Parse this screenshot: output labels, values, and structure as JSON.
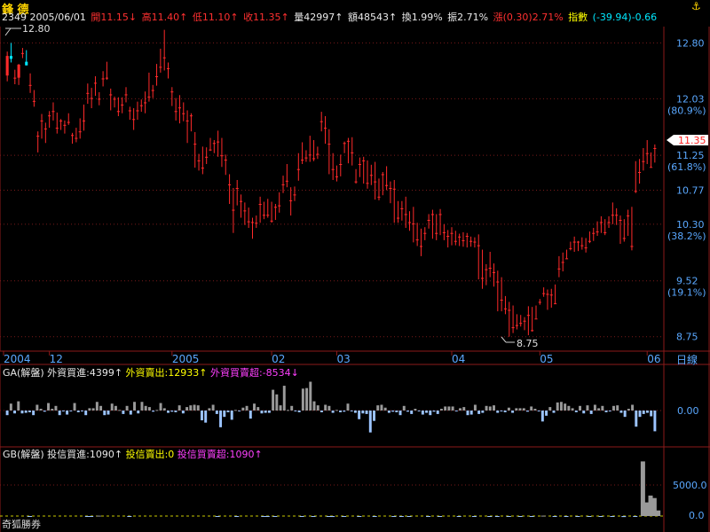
{
  "header": {
    "ticker_name": "鋒 德",
    "code_date": "2349 2005/06/01",
    "open": "開11.15↓",
    "high": "高11.40↑",
    "low": "低11.10↑",
    "close": "收11.35↑",
    "volume": "量42997↑",
    "amount": "額48543↑",
    "turnover": "換1.99%",
    "amplitude": "振2.71%",
    "change": "漲(0.30)2.71%",
    "index_label": "指數",
    "index_value": "(-39.94)-0.66",
    "anchor_icon": "anchor-icon"
  },
  "colors": {
    "up": "#ff2a2a",
    "down": "#00e6ff",
    "grid": "#7a1a1a",
    "frame": "#8b1a1a",
    "axis_text": "#5aa8ff",
    "pos_bar": "#9a9a9a",
    "neg_bar": "#9cc4ff"
  },
  "chart_data": [
    {
      "type": "candlestick",
      "title": "",
      "y_ticks": [
        "12.80",
        "12.03",
        "11.25",
        "10.77",
        "10.30",
        "9.52",
        "8.75"
      ],
      "y_pct_ticks": [
        "(80.9%)",
        "(61.8%)",
        "(38.2%)",
        "(19.1%)"
      ],
      "ylim": [
        8.6,
        13.0
      ],
      "x_ticks": [
        "2004",
        "12",
        "2005",
        "02",
        "03",
        "04",
        "05",
        "06"
      ],
      "x_period_label": "日線",
      "current_price_label": "11.35",
      "max_annotation": "12.80",
      "min_annotation": "8.75",
      "ohlc_open": [
        12.35,
        12.62,
        12.32,
        12.32,
        12.66,
        12.54,
        12.22,
        12.0,
        11.52,
        11.73,
        11.62,
        11.8,
        11.86,
        11.63,
        11.73,
        11.67,
        11.71,
        11.53,
        11.49,
        11.58,
        11.73,
        12.11,
        12.04,
        12.25,
        12.03,
        12.31,
        12.32,
        12.09,
        12.03,
        11.86,
        11.95,
        12.09,
        11.87,
        11.75,
        11.87,
        11.94,
        11.98,
        12.06,
        12.15,
        12.34,
        12.47,
        12.6,
        12.45,
        12.13,
        11.86,
        11.91,
        11.83,
        11.73,
        11.8,
        11.41,
        11.18,
        11.08,
        11.23,
        11.33,
        11.42,
        11.44,
        11.25,
        11.19,
        10.85,
        10.5,
        10.8,
        10.62,
        10.49,
        10.34,
        10.33,
        10.32,
        10.58,
        10.43,
        10.43,
        10.35,
        10.54,
        10.56,
        10.85,
        10.9,
        10.63,
        10.71,
        11.06,
        11.19,
        11.22,
        11.26,
        11.21,
        11.27,
        11.72,
        11.63,
        11.41,
        11.06,
        10.96,
        11.13,
        11.42,
        11.45,
        11.29,
        10.89,
        11.13,
        11.18,
        10.87,
        10.98,
        10.89,
        10.68,
        10.99,
        10.84,
        10.8,
        10.79,
        10.39,
        10.52,
        10.44,
        10.33,
        10.31,
        10.09,
        10.0,
        10.18,
        10.36,
        10.44,
        10.18,
        10.44,
        10.19,
        10.14,
        10.18,
        10.07,
        10.13,
        10.08,
        10.14,
        10.07,
        10.06,
        10.01,
        9.56,
        9.68,
        9.7,
        9.64,
        9.51,
        9.26,
        9.14,
        9.12,
        8.88,
        8.91,
        8.94,
        8.97,
        9.05,
        8.84,
        9.0,
        9.23,
        9.35,
        9.34,
        9.33,
        9.21,
        9.69,
        9.78,
        9.83,
        9.97,
        10.06,
        10.06,
        10.01,
        9.98,
        10.07,
        10.18,
        10.2,
        10.33,
        10.19,
        10.33,
        10.43,
        10.43,
        10.36,
        10.11,
        10.42,
        10.0,
        10.76,
        11.02,
        11.17,
        11.28,
        11.09,
        11.35
      ],
      "ohlc_high": [
        12.68,
        12.8,
        12.43,
        12.51,
        12.73,
        12.7,
        12.38,
        12.15,
        11.58,
        11.82,
        11.7,
        11.86,
        11.98,
        11.84,
        11.75,
        11.73,
        11.83,
        11.56,
        11.63,
        11.76,
        11.95,
        12.24,
        12.18,
        12.34,
        12.12,
        12.41,
        12.54,
        12.17,
        12.06,
        12.05,
        12.05,
        12.19,
        11.92,
        11.9,
        11.99,
        12.02,
        12.13,
        12.39,
        12.22,
        12.51,
        12.72,
        12.98,
        12.53,
        12.19,
        12.04,
        12.08,
        11.98,
        11.87,
        11.83,
        11.57,
        11.27,
        11.37,
        11.36,
        11.49,
        11.46,
        11.59,
        11.49,
        11.26,
        10.99,
        10.8,
        10.91,
        10.71,
        10.6,
        10.53,
        10.39,
        10.42,
        10.68,
        10.61,
        10.65,
        10.61,
        10.58,
        10.74,
        10.97,
        11.13,
        10.81,
        10.82,
        11.28,
        11.43,
        11.32,
        11.52,
        11.46,
        11.37,
        11.85,
        11.79,
        11.61,
        11.28,
        11.11,
        11.26,
        11.44,
        11.49,
        11.5,
        11.06,
        11.22,
        11.23,
        11.18,
        11.12,
        11.16,
        10.93,
        11.02,
        11.1,
        10.89,
        10.91,
        10.62,
        10.62,
        10.68,
        10.48,
        10.54,
        10.32,
        10.24,
        10.26,
        10.44,
        10.5,
        10.44,
        10.51,
        10.3,
        10.22,
        10.26,
        10.21,
        10.17,
        10.19,
        10.18,
        10.13,
        10.12,
        10.16,
        9.95,
        9.75,
        9.92,
        9.76,
        9.66,
        9.57,
        9.31,
        9.23,
        9.18,
        9.06,
        9.05,
        9.02,
        9.17,
        9.16,
        9.18,
        9.27,
        9.43,
        9.4,
        9.41,
        9.47,
        9.86,
        9.91,
        9.95,
        10.06,
        10.13,
        10.07,
        10.12,
        10.11,
        10.2,
        10.25,
        10.34,
        10.41,
        10.37,
        10.41,
        10.6,
        10.52,
        10.42,
        10.37,
        10.5,
        10.54,
        11.17,
        11.2,
        11.35,
        11.46,
        11.29,
        11.4
      ],
      "ohlc_low": [
        12.27,
        12.53,
        12.23,
        12.22,
        12.59,
        12.49,
        12.11,
        11.92,
        11.29,
        11.48,
        11.42,
        11.63,
        11.73,
        11.55,
        11.6,
        11.55,
        11.67,
        11.41,
        11.43,
        11.48,
        11.59,
        11.96,
        11.9,
        12.07,
        11.94,
        12.2,
        12.29,
        11.87,
        11.91,
        11.79,
        11.83,
        11.98,
        11.74,
        11.6,
        11.74,
        11.85,
        11.83,
        11.99,
        12.04,
        12.21,
        12.39,
        12.42,
        12.31,
        11.93,
        11.73,
        11.69,
        11.72,
        11.42,
        11.58,
        11.08,
        11.04,
        10.99,
        11.13,
        11.31,
        11.28,
        11.23,
        11.09,
        10.98,
        10.58,
        10.18,
        10.56,
        10.39,
        10.29,
        10.25,
        10.1,
        10.25,
        10.32,
        10.37,
        10.39,
        10.32,
        10.36,
        10.46,
        10.73,
        10.81,
        10.42,
        10.62,
        10.9,
        11.13,
        11.16,
        11.16,
        11.17,
        11.2,
        11.58,
        11.41,
        10.99,
        10.91,
        10.89,
        10.96,
        11.28,
        11.14,
        11.11,
        10.86,
        10.95,
        10.86,
        10.79,
        10.84,
        10.64,
        10.63,
        10.7,
        10.77,
        10.59,
        10.32,
        10.32,
        10.35,
        10.25,
        10.21,
        10.05,
        10.0,
        9.86,
        10.08,
        10.24,
        10.1,
        10.08,
        10.15,
        10.08,
        9.98,
        10.01,
        10.01,
        10.0,
        9.99,
        9.98,
        9.99,
        9.98,
        9.54,
        9.41,
        9.46,
        9.57,
        9.44,
        9.1,
        9.1,
        9.06,
        8.75,
        8.8,
        8.85,
        8.89,
        8.84,
        8.77,
        8.82,
        9.0,
        9.19,
        9.3,
        9.12,
        9.15,
        9.21,
        9.57,
        9.65,
        9.83,
        9.94,
        9.92,
        9.93,
        9.95,
        9.91,
        10.04,
        10.07,
        10.14,
        10.18,
        10.15,
        10.25,
        10.3,
        10.29,
        10.03,
        10.06,
        10.14,
        9.94,
        10.73,
        10.86,
        11.04,
        11.13,
        11.09,
        11.15
      ],
      "ohlc_close": [
        12.62,
        12.58,
        12.32,
        12.5,
        12.66,
        12.49,
        12.22,
        12.0,
        11.52,
        11.73,
        11.62,
        11.8,
        11.86,
        11.63,
        11.73,
        11.67,
        11.71,
        11.53,
        11.49,
        11.58,
        11.73,
        12.11,
        12.04,
        12.25,
        12.03,
        12.31,
        12.32,
        12.09,
        12.03,
        11.86,
        11.95,
        12.09,
        11.87,
        11.75,
        11.87,
        11.94,
        11.98,
        12.06,
        12.15,
        12.34,
        12.47,
        12.6,
        12.45,
        12.13,
        11.86,
        11.91,
        11.83,
        11.73,
        11.8,
        11.41,
        11.18,
        11.08,
        11.23,
        11.33,
        11.42,
        11.44,
        11.25,
        11.19,
        10.85,
        10.5,
        10.8,
        10.62,
        10.49,
        10.34,
        10.33,
        10.32,
        10.58,
        10.43,
        10.43,
        10.35,
        10.54,
        10.56,
        10.85,
        10.9,
        10.63,
        10.71,
        11.06,
        11.19,
        11.22,
        11.26,
        11.21,
        11.27,
        11.72,
        11.63,
        11.41,
        11.06,
        10.96,
        11.13,
        11.42,
        11.45,
        11.29,
        10.89,
        11.13,
        11.18,
        10.87,
        10.98,
        10.89,
        10.68,
        10.99,
        10.84,
        10.8,
        10.79,
        10.39,
        10.52,
        10.44,
        10.33,
        10.31,
        10.09,
        10.0,
        10.18,
        10.36,
        10.44,
        10.18,
        10.44,
        10.19,
        10.14,
        10.18,
        10.07,
        10.13,
        10.08,
        10.14,
        10.07,
        10.06,
        10.01,
        9.56,
        9.68,
        9.7,
        9.64,
        9.51,
        9.26,
        9.14,
        9.12,
        8.88,
        8.91,
        8.94,
        8.97,
        9.05,
        8.84,
        9.0,
        9.23,
        9.35,
        9.34,
        9.33,
        9.21,
        9.69,
        9.78,
        9.83,
        9.97,
        10.06,
        10.06,
        10.01,
        9.98,
        10.07,
        10.18,
        10.2,
        10.33,
        10.19,
        10.33,
        10.43,
        10.43,
        10.36,
        10.11,
        10.42,
        10.0,
        10.76,
        11.02,
        11.17,
        11.28,
        11.09,
        11.35
      ]
    },
    {
      "type": "bar",
      "title": "GA(解盤) 外資買進:4399↑外資賣出:12933↑外資買賣超:-8534↓",
      "labels": {
        "prefix": "GA(解盤) 外資買進:4399↑",
        "sell": "外資賣出:12933↑",
        "net": "外資買賣超:-8534↓"
      },
      "y_ticks": [
        "0.00"
      ],
      "values": [
        -0.8,
        1.2,
        -0.5,
        1.6,
        -0.5,
        -0.4,
        -0.3,
        -0.8,
        1.0,
        0.3,
        -0.2,
        1.3,
        0.3,
        0.8,
        -0.8,
        -0.1,
        -0.7,
        -0.1,
        1.3,
        -0.3,
        -0.1,
        -0.8,
        0.4,
        0.4,
        1.5,
        0.8,
        -0.8,
        -0.7,
        1.2,
        0.8,
        0.1,
        -0.6,
        0.8,
        -0.7,
        1.5,
        -0.5,
        1.5,
        0.8,
        0.6,
        -0.2,
        0.1,
        1.3,
        0.4,
        -0.4,
        -0.2,
        -0.3,
        0.9,
        -0.5,
        0.6,
        0.9,
        1.0,
        0.9,
        -1.7,
        -2.1,
        0.4,
        1.0,
        -0.6,
        -2.9,
        -1.1,
        -0.3,
        -1.6,
        0.1,
        -0.1,
        0.5,
        0.8,
        -1.4,
        1.2,
        0.6,
        -0.5,
        -0.4,
        -0.4,
        3.6,
        2.8,
        0.9,
        4.3,
        0.1,
        0.8,
        -0.1,
        -0.3,
        3.8,
        3.9,
        5.0,
        1.6,
        0.9,
        -0.3,
        1.0,
        0.8,
        -0.4,
        0.1,
        -0.3,
        -0.2,
        1.2,
        -0.1,
        -0.4,
        -1.5,
        -0.5,
        -0.6,
        -3.8,
        -1.8,
        0.9,
        1.0,
        0.5,
        -0.4,
        -0.2,
        -0.3,
        -0.8,
        0.8,
        -0.2,
        -0.6,
        0.3,
        -0.1,
        -0.7,
        -0.4,
        -0.8,
        -0.2,
        -0.6,
        0.3,
        0.7,
        0.7,
        0.7,
        -0.1,
        0.4,
        0.6,
        -0.8,
        -0.7,
        1.0,
        -0.6,
        -0.4,
        0.8,
        0.7,
        0.9,
        -0.4,
        -0.1,
        -0.3,
        0.5,
        -0.4,
        0.4,
        0.4,
        0.4,
        -0.2,
        0.7,
        0.3,
        -0.1,
        -1.9,
        -0.9,
        0.6,
        -0.4,
        1.4,
        1.5,
        1.2,
        0.8,
        0.4,
        -0.3,
        0.8,
        -0.5,
        0.9,
        -0.6,
        1.0,
        0.4,
        0.8,
        -0.3,
        -0.1,
        0.8,
        0.9,
        -0.4,
        -1.1,
        0.3,
        1.0,
        -2.8,
        -1.1,
        -0.6,
        -0.4,
        -1.0,
        -3.6
      ]
    },
    {
      "type": "bar",
      "title": "GB(解盤) 投信買進:1090↑投信賣出:0 投信買賣超:1090↑",
      "labels": {
        "prefix": "GB(解盤) 投信買進:1090↑",
        "sell": "投信賣出:0",
        "net": "投信買賣超:1090↑"
      },
      "y_ticks": [
        "5000.0",
        "0.0"
      ],
      "footer": "奇狐勝券",
      "values_index": [
        6,
        21,
        22,
        24,
        32,
        55,
        60,
        67,
        68,
        70,
        77,
        80,
        84,
        85,
        88,
        92,
        96,
        101,
        103,
        105,
        110,
        113,
        118,
        122,
        126,
        128,
        131,
        134,
        137,
        140,
        143,
        146,
        149,
        152,
        155,
        158,
        161,
        164,
        166,
        167,
        168,
        169,
        170
      ],
      "values": [
        -100,
        -80,
        -60,
        60,
        -120,
        -60,
        -90,
        -80,
        -70,
        -50,
        -90,
        -60,
        -80,
        -150,
        -60,
        -80,
        -60,
        -70,
        -50,
        -80,
        -60,
        -80,
        -60,
        -80,
        -60,
        -80,
        -50,
        -60,
        -40,
        60,
        -60,
        -40,
        -80,
        -60,
        -100,
        -60,
        -160,
        -80,
        8800,
        2200,
        3300,
        2900,
        900
      ]
    }
  ]
}
